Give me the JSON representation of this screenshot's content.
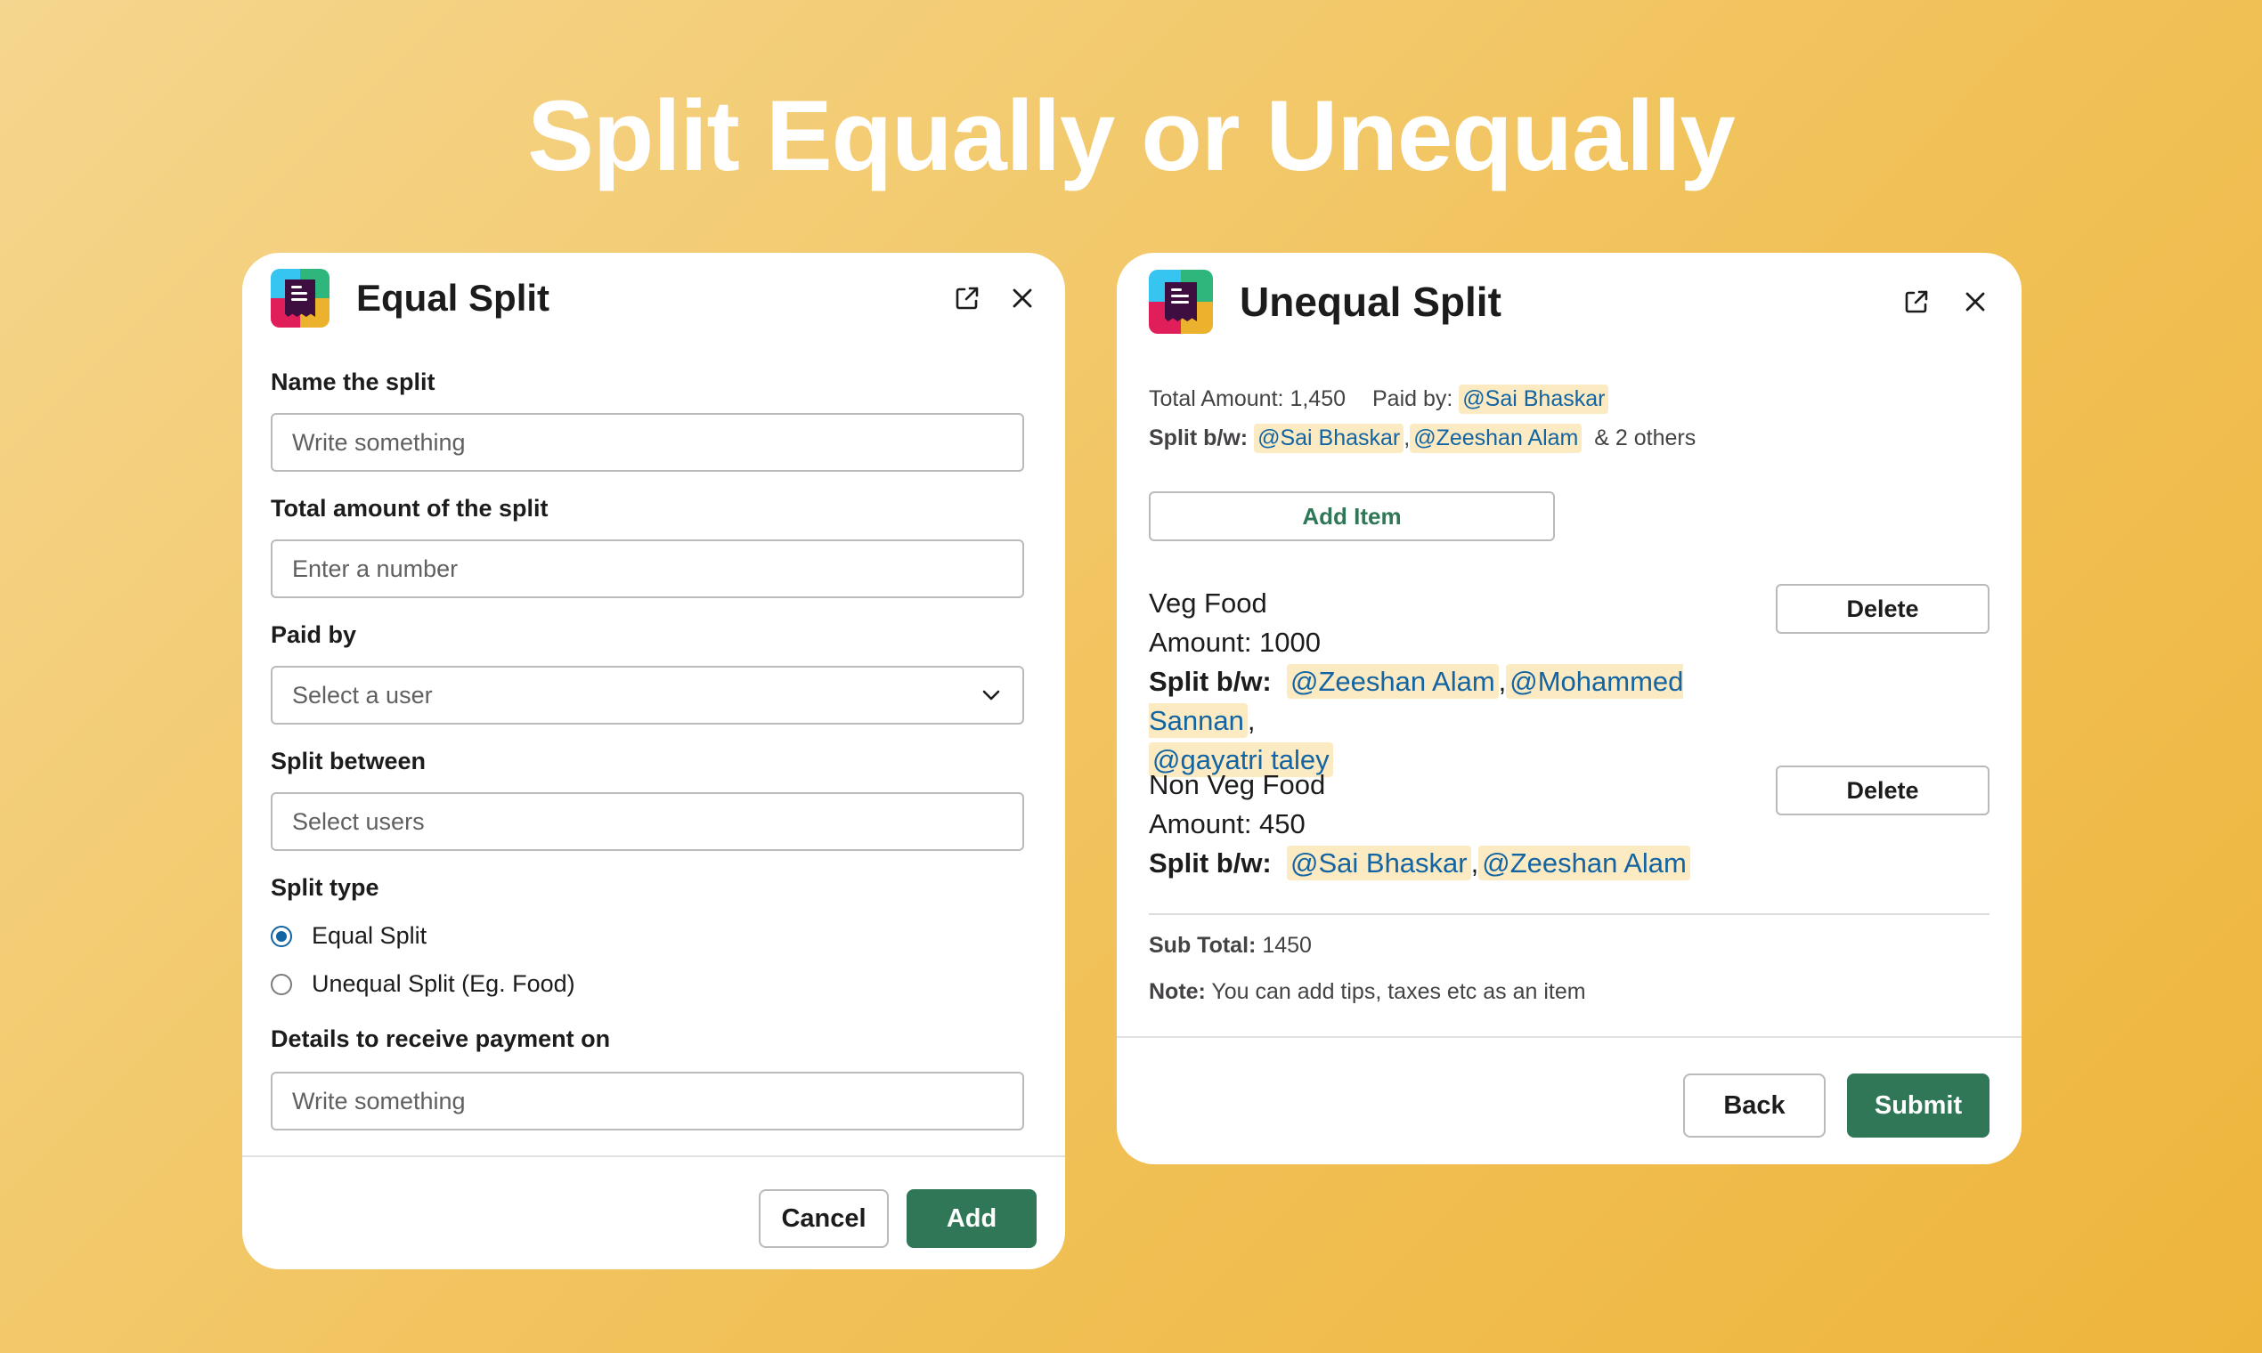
{
  "headline": "Split Equally or Unequally",
  "equal_modal": {
    "title": "Equal Split",
    "name_label": "Name the split",
    "name_placeholder": "Write something",
    "amount_label": "Total amount of the split",
    "amount_placeholder": "Enter a number",
    "paid_by_label": "Paid by",
    "paid_by_placeholder": "Select a user",
    "split_between_label": "Split between",
    "split_between_placeholder": "Select users",
    "split_type_label": "Split type",
    "split_type_options": [
      {
        "label": "Equal Split",
        "selected": true
      },
      {
        "label": "Unequal Split (Eg. Food)",
        "selected": false
      }
    ],
    "details_label": "Details to receive payment on",
    "details_placeholder": "Write something",
    "cancel_label": "Cancel",
    "add_label": "Add"
  },
  "unequal_modal": {
    "title": "Unequal Split",
    "total_amount_label": "Total Amount:",
    "total_amount_value": "1,450",
    "paid_by_label": "Paid by:",
    "paid_by_user": "@Sai Bhaskar",
    "split_bw_label": "Split b/w:",
    "split_bw_users": [
      "@Sai Bhaskar",
      "@Zeeshan Alam"
    ],
    "split_bw_others": "& 2 others",
    "add_item_label": "Add Item",
    "items": [
      {
        "name": "Veg Food",
        "amount": "Amount: 1000",
        "split_label": "Split b/w:",
        "users": [
          "@Zeeshan Alam",
          "@Mohammed Sannan",
          "@gayatri taley"
        ],
        "delete_label": "Delete"
      },
      {
        "name": "Non Veg Food",
        "amount": "Amount: 450",
        "split_label": "Split b/w:",
        "users": [
          "@Sai Bhaskar",
          "@Zeeshan Alam"
        ],
        "delete_label": "Delete"
      }
    ],
    "subtotal_label": "Sub Total:",
    "subtotal_value": "1450",
    "note_label": "Note:",
    "note_text": "You can add tips, taxes etc as an item",
    "back_label": "Back",
    "submit_label": "Submit"
  },
  "icons": {
    "app": "receipt-app-icon",
    "external": "external-link-icon",
    "close": "close-icon",
    "dropdown": "chevron-down-icon"
  },
  "colors": {
    "primary_button": "#2f7756",
    "mention_text": "#1264a3",
    "mention_bg": "#fbeac2",
    "radio_selected": "#1264a3"
  }
}
